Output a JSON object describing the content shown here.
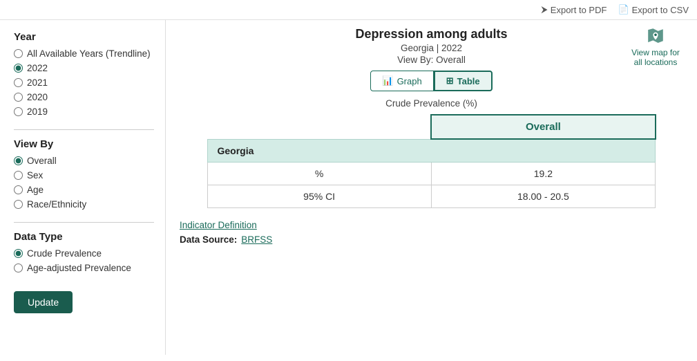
{
  "topbar": {
    "export_pdf_label": "Export to PDF",
    "export_csv_label": "Export to CSV"
  },
  "sidebar": {
    "year_section_title": "Year",
    "year_options": [
      {
        "id": "all",
        "label": "All Available Years (Trendline)",
        "checked": false
      },
      {
        "id": "2022",
        "label": "2022",
        "checked": true
      },
      {
        "id": "2021",
        "label": "2021",
        "checked": false
      },
      {
        "id": "2020",
        "label": "2020",
        "checked": false
      },
      {
        "id": "2019",
        "label": "2019",
        "checked": false
      }
    ],
    "viewby_section_title": "View By",
    "viewby_options": [
      {
        "id": "overall",
        "label": "Overall",
        "checked": true
      },
      {
        "id": "sex",
        "label": "Sex",
        "checked": false
      },
      {
        "id": "age",
        "label": "Age",
        "checked": false
      },
      {
        "id": "race",
        "label": "Race/Ethnicity",
        "checked": false
      }
    ],
    "datatype_section_title": "Data Type",
    "datatype_options": [
      {
        "id": "crude",
        "label": "Crude Prevalence",
        "checked": true
      },
      {
        "id": "ageadj",
        "label": "Age-adjusted Prevalence",
        "checked": false
      }
    ],
    "update_button_label": "Update"
  },
  "content": {
    "main_title": "Depression among adults",
    "subtitle": "Georgia | 2022",
    "view_by": "View By: Overall",
    "tab_graph_label": "Graph",
    "tab_table_label": "Table",
    "crude_prevalence_label": "Crude Prevalence (%)",
    "map_link_label": "View map for all locations",
    "overall_header": "Overall",
    "georgia_row_label": "Georgia",
    "table_col_pct": "%",
    "table_col_ci": "95% CI",
    "table_val_pct": "19.2",
    "table_val_ci": "18.00 - 20.5",
    "indicator_definition_label": "Indicator Definition",
    "data_source_label": "Data Source:",
    "brfss_label": "BRFSS"
  }
}
